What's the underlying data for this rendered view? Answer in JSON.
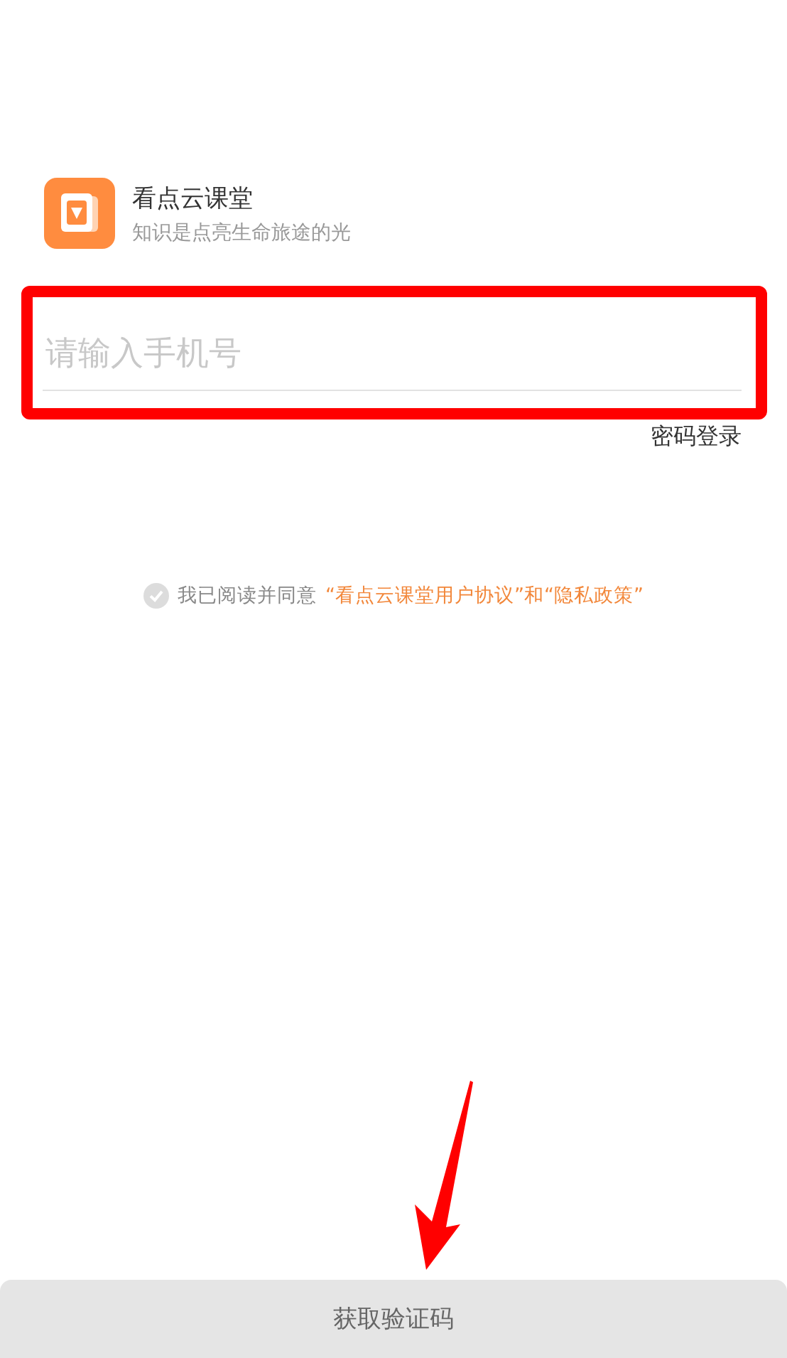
{
  "app": {
    "name": "看点云课堂",
    "slogan": "知识是点亮生命旅途的光"
  },
  "phone_field": {
    "placeholder": "请输入手机号",
    "highlighted": true
  },
  "password_login_link": "密码登录",
  "agreement": {
    "checked": false,
    "prefix": "我已阅读并同意",
    "link": "“看点云课堂用户协议”和“隐私政策”"
  },
  "annotation_arrow": true,
  "submit_button": {
    "label": "获取验证码",
    "disabled": true
  }
}
